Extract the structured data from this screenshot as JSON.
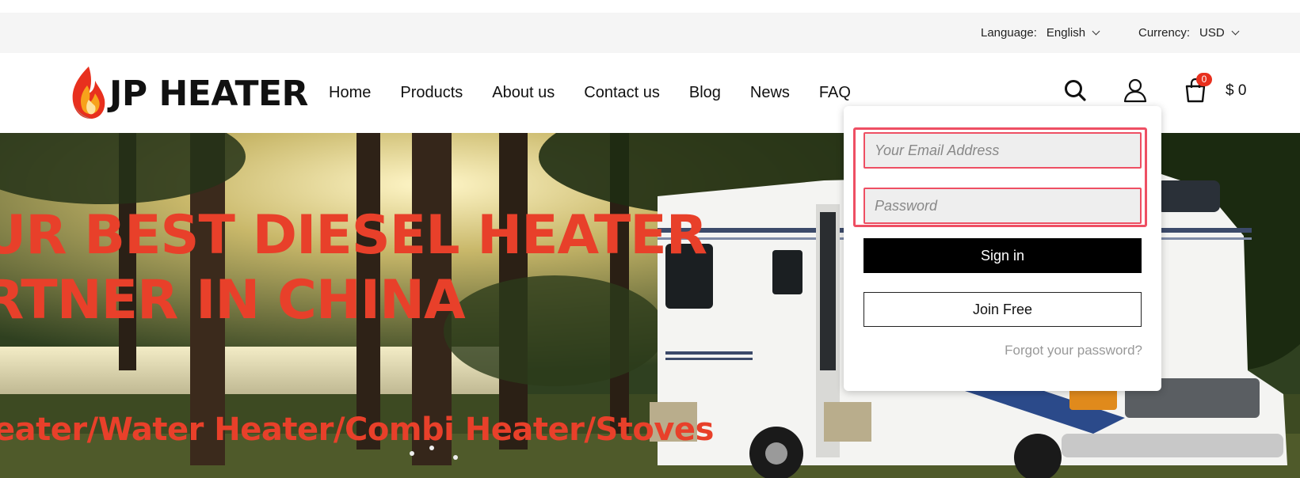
{
  "topbar": {
    "language_label": "Language:",
    "language_value": "English",
    "currency_label": "Currency:",
    "currency_value": "USD"
  },
  "header": {
    "logo_text": "JP HEATER",
    "nav": [
      "Home",
      "Products",
      "About us",
      "Contact us",
      "Blog",
      "News",
      "FAQ"
    ],
    "cart_count": "0",
    "cart_total": "$ 0"
  },
  "hero": {
    "headline_line1": "UR BEST DIESEL HEATER",
    "headline_line2": "RTNER IN CHINA",
    "subline": "eater/Water Heater/Combi Heater/Stoves"
  },
  "login": {
    "email_placeholder": "Your Email Address",
    "password_placeholder": "Password",
    "signin_label": "Sign in",
    "join_label": "Join Free",
    "forgot_label": "Forgot your password?"
  },
  "colors": {
    "accent_red": "#e8402a",
    "badge_red": "#e8301e",
    "focus_border": "#ee4f63",
    "topbar_bg": "#f5f5f5"
  },
  "icons": [
    "flame-logo-icon",
    "chevron-down-icon",
    "search-icon",
    "user-icon",
    "cart-icon"
  ]
}
